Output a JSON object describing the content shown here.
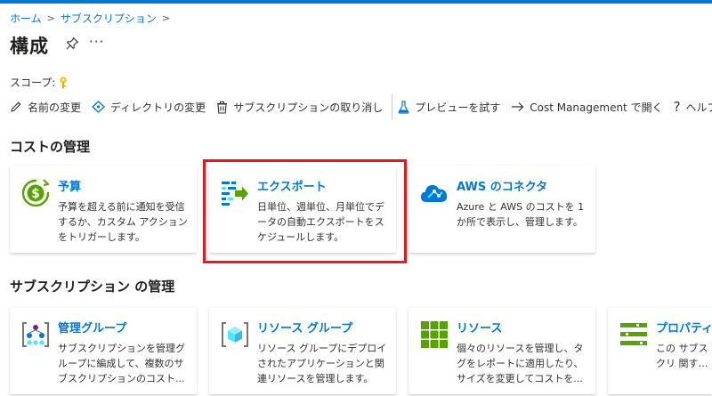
{
  "breadcrumb": {
    "home": "ホーム",
    "subscriptions": "サブスクリプション",
    "sep": ">"
  },
  "page": {
    "title": "構成",
    "more": "···"
  },
  "scope": {
    "label": "スコープ:"
  },
  "toolbar": {
    "rename": "名前の変更",
    "change_directory": "ディレクトリの変更",
    "cancel_subscription": "サブスクリプションの取り消し",
    "try_preview": "プレビューを試す",
    "open_cost_management": "Cost Management で開く",
    "help": "ヘルプ"
  },
  "cost_section": {
    "title": "コストの管理",
    "cards": [
      {
        "title": "予算",
        "desc": "予算を超える前に通知を受信するか、カスタム アクションをトリガーします。"
      },
      {
        "title": "エクスポート",
        "desc": "日単位、週単位、月単位でデータの自動エクスポートをスケジュールします。"
      },
      {
        "title": "AWS のコネクタ",
        "desc": "Azure と AWS のコストを 1 か所で表示し、管理します。"
      }
    ]
  },
  "subscription_section": {
    "title": "サブスクリプション の管理",
    "cards": [
      {
        "title": "管理グループ",
        "desc": "サブスクリプションを管理グループに編成して、複数のサブスクリプションのコスト..."
      },
      {
        "title": "リソース グループ",
        "desc": "リソース グループにデプロイされたアプリケーションと関連リソースを管理します。"
      },
      {
        "title": "リソース",
        "desc": "個々のリソースを管理し、タグをレポートに適用したり、サイズを変更してコストを..."
      },
      {
        "title": "プロパティ",
        "desc": "この サブスクリ 関する追加の"
      }
    ]
  },
  "colors": {
    "accent": "#0078d4",
    "highlight": "#e21b23",
    "green": "#57a300"
  }
}
